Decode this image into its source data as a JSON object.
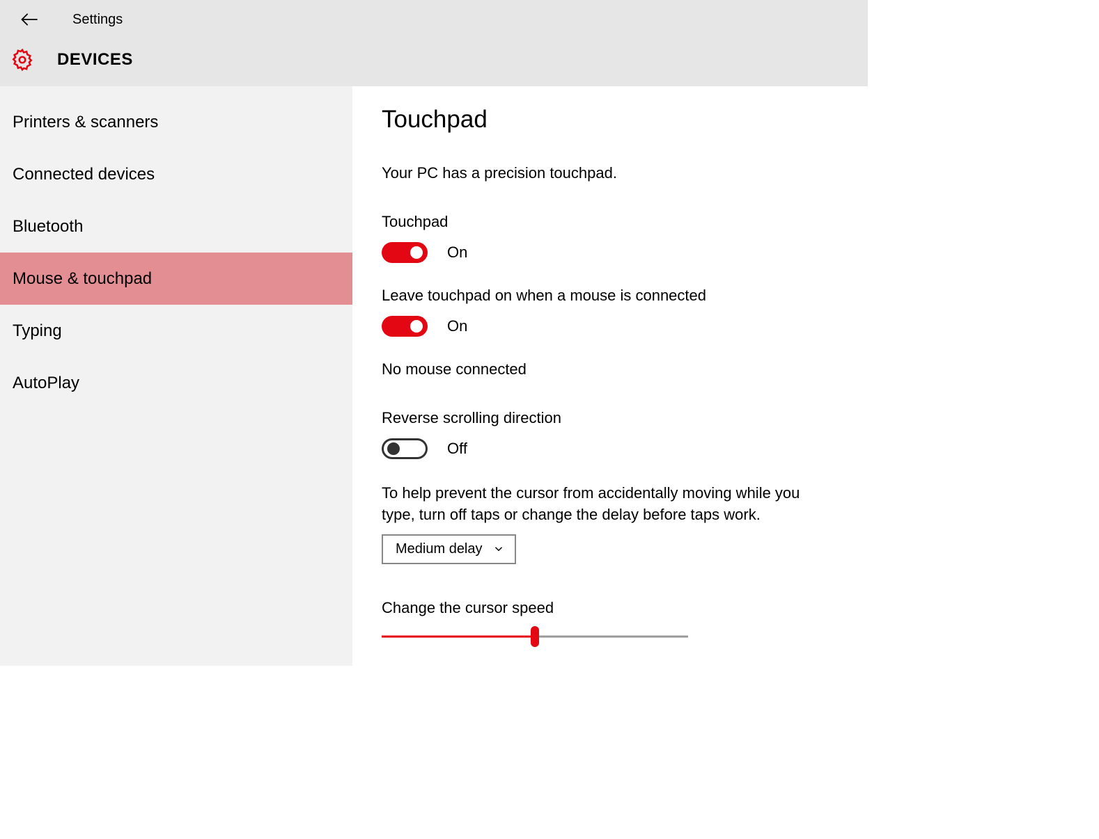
{
  "header": {
    "title": "Settings",
    "section": "DEVICES"
  },
  "sidebar": {
    "items": [
      {
        "label": "Printers & scanners"
      },
      {
        "label": "Connected devices"
      },
      {
        "label": "Bluetooth"
      },
      {
        "label": "Mouse & touchpad"
      },
      {
        "label": "Typing"
      },
      {
        "label": "AutoPlay"
      }
    ]
  },
  "main": {
    "title": "Touchpad",
    "subtitle": "Your PC has a precision touchpad.",
    "touchpad_toggle": {
      "label": "Touchpad",
      "state": "On"
    },
    "leave_on_toggle": {
      "label": "Leave touchpad on when a mouse is connected",
      "state": "On"
    },
    "mouse_status": "No mouse connected",
    "reverse_scroll": {
      "label": "Reverse scrolling direction",
      "state": "Off"
    },
    "tap_help": "To help prevent the cursor from accidentally moving while you type, turn off taps or change the delay before taps work.",
    "delay_dropdown": {
      "selected": "Medium delay"
    },
    "cursor_speed": {
      "label": "Change the cursor speed",
      "value_percent": 50
    }
  },
  "colors": {
    "accent": "#e30613",
    "sidebar_active": "#e28e93"
  }
}
